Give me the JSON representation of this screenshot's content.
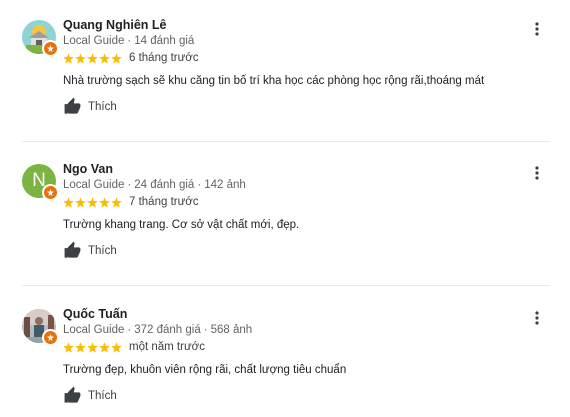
{
  "reviews": [
    {
      "name": "Quang Nghiên Lê",
      "guide_label": "Local Guide",
      "review_count": "14 đánh giá",
      "photo_count": "",
      "rating": 5,
      "time": "6 tháng trước",
      "text": "Nhà trường sạch sẽ khu căng tin bố trí kha học các phòng học rộng rãi,thoáng mát",
      "like_label": "Thích",
      "avatar_icon": "house-illustration-icon"
    },
    {
      "name": "Ngo Van",
      "guide_label": "Local Guide",
      "review_count": "24 đánh giá",
      "photo_count": "142 ảnh",
      "rating": 5,
      "time": "7 tháng trước",
      "text": "Trường khang trang. Cơ sở vật chất mới, đẹp.",
      "like_label": "Thích",
      "avatar_letter": "N",
      "avatar_color": "#7cb342"
    },
    {
      "name": "Quốc Tuấn",
      "guide_label": "Local Guide",
      "review_count": "372 đánh giá",
      "photo_count": "568 ảnh",
      "rating": 5,
      "time": "một năm trước",
      "text": "Trường đẹp, khuôn viên rộng rãi, chất lượng tiêu chuẩn",
      "like_label": "Thích",
      "avatar_icon": "person-photo-icon"
    }
  ],
  "colors": {
    "star": "#fbbc04",
    "badge": "#e8710a",
    "meta_text": "#5f6368"
  }
}
